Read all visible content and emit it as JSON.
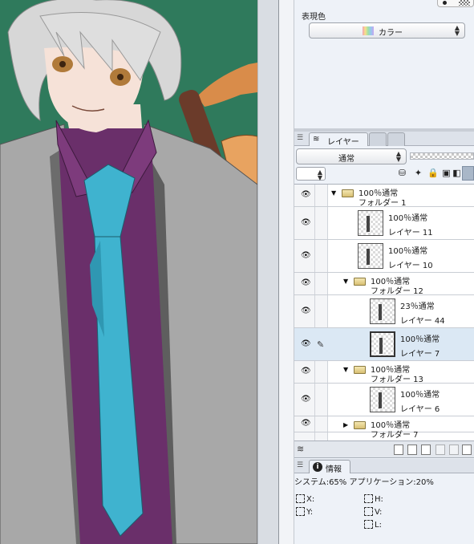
{
  "panel_top": {
    "expression_color_label": "表現色",
    "expression_color_value": "カラー"
  },
  "layer_panel": {
    "tab_label": "レイヤー",
    "blend_mode": "通常",
    "layers": [
      {
        "type": "folder",
        "expanded": true,
        "props": "100％通常",
        "name": "フォルダー 1",
        "indent": 0
      },
      {
        "type": "layer",
        "props": "100％通常",
        "name": "レイヤー 11",
        "indent": 1
      },
      {
        "type": "layer",
        "props": "100％通常",
        "name": "レイヤー 10",
        "indent": 1
      },
      {
        "type": "folder",
        "expanded": true,
        "props": "100％通常",
        "name": "フォルダー 12",
        "indent": 1
      },
      {
        "type": "layer",
        "props": "23％通常",
        "name": "レイヤー 44",
        "indent": 2
      },
      {
        "type": "layer",
        "props": "100％通常",
        "name": "レイヤー 7",
        "indent": 2,
        "selected": true
      },
      {
        "type": "folder",
        "expanded": true,
        "props": "100％通常",
        "name": "フォルダー 13",
        "indent": 1
      },
      {
        "type": "layer",
        "props": "100％通常",
        "name": "レイヤー 6",
        "indent": 2
      },
      {
        "type": "folder",
        "expanded": false,
        "props": "100％通常",
        "name": "フォルダー 7",
        "indent": 1
      }
    ]
  },
  "info_panel": {
    "tab_label": "情報",
    "system_line": "システム:65% アプリケーション:20%",
    "coords": {
      "x": "X:",
      "y": "Y:",
      "h": "H:",
      "v": "V:",
      "l": "L:"
    }
  },
  "icons": {
    "eye": "eye-icon",
    "pen": "pen-icon",
    "folder": "folder-icon",
    "info": "info-icon",
    "layers": "layers-icon"
  },
  "colors": {
    "canvas_bg": "#2f7a5c",
    "shirt": "#6a2f6a",
    "tie": "#3fb3cf",
    "jacket": "#a8a8a8",
    "selected_row": "#dbe8f4"
  }
}
